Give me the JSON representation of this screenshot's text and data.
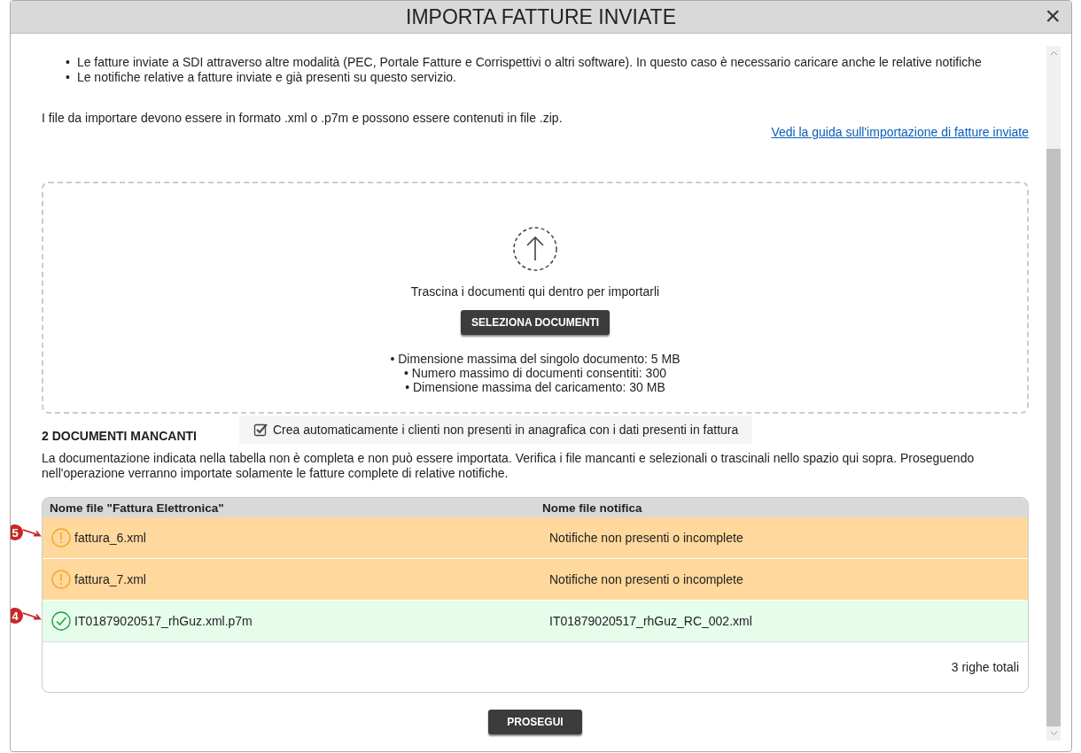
{
  "dialog": {
    "title": "IMPORTA FATTURE INVIATE",
    "close": "×"
  },
  "intro": {
    "items": [
      {
        "bullet": "•",
        "text": "Le fatture inviate a SDI attraverso altre modalità (PEC, Portale Fatture e Corrispettivi o altri software). In questo caso è necessario caricare anche le relative notifiche"
      },
      {
        "bullet": "•",
        "text": "Le notifiche relative a fatture inviate e già presenti su questo servizio."
      }
    ],
    "format_note": "I file da importare devono essere in formato .xml o .p7m e possono essere contenuti in file .zip.",
    "guide_link": "Vedi la guida sull'importazione di fatture inviate"
  },
  "dropzone": {
    "hint": "Trascina i documenti qui dentro per importarli",
    "button": "SELEZIONA DOCUMENTI",
    "limits": [
      "• Dimensione massima del singolo documento: 5 MB",
      "• Numero massimo di documenti consentiti: 300",
      "• Dimensione massima del caricamento: 30 MB"
    ]
  },
  "missing": {
    "heading": "2 DOCUMENTI MANCANTI",
    "auto_create": {
      "label": "Crea automaticamente i clienti non presenti in anagrafica con i dati presenti in fattura",
      "checked": true
    },
    "description": "La documentazione indicata nella tabella non è completa e non può essere importata. Verifica i file mancanti e selezionali o trascinali nello spazio qui sopra. Proseguendo nell'operazione verranno importate solamente le fatture complete di relative notifiche."
  },
  "table": {
    "columns": [
      "Nome file \"Fattura Elettronica\"",
      "Nome file notifica"
    ],
    "rows": [
      {
        "kind": "warning",
        "file": "fattura_6.xml",
        "notification": "Notifiche non presenti o incomplete",
        "callout": "5"
      },
      {
        "kind": "warning",
        "file": "fattura_7.xml",
        "notification": "Notifiche non presenti o incomplete"
      },
      {
        "kind": "ok",
        "file": "IT01879020517_rhGuz.xml.p7m",
        "notification": "IT01879020517_rhGuz_RC_002.xml",
        "callout": "4"
      }
    ],
    "total": "3 righe totali"
  },
  "footer": {
    "button": "PROSEGUI"
  }
}
